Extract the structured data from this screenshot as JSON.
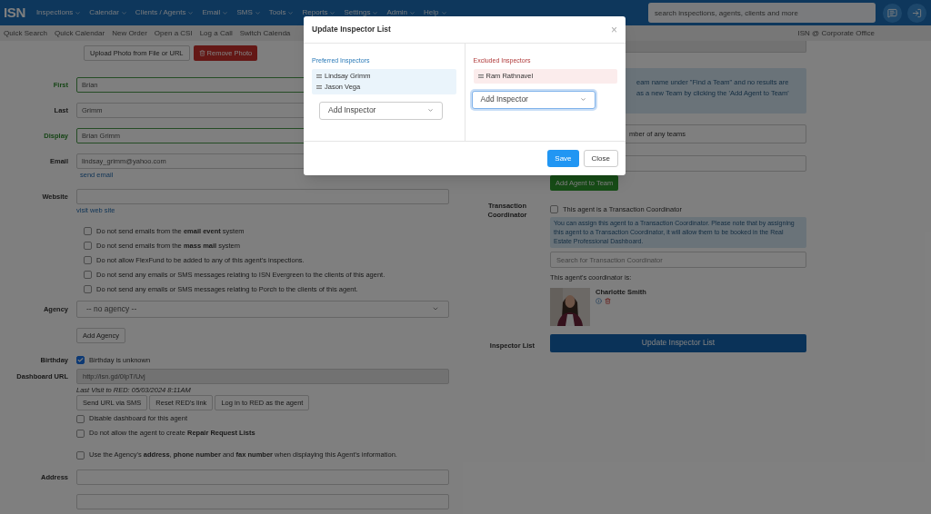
{
  "nav": {
    "logo": "ISN",
    "menus": [
      "Inspections",
      "Calendar",
      "Clients / Agents",
      "Email",
      "SMS",
      "Tools",
      "Reports",
      "Settings",
      "Admin",
      "Help"
    ],
    "search": {
      "placeholder": "search inspections, agents, clients and more"
    }
  },
  "quick_links": [
    "Quick Search",
    "Quick Calendar",
    "New Order",
    "Open a CSI",
    "Log a Call",
    "Switch Calenda"
  ],
  "office": "ISN @ Corporate Office",
  "photo_buttons": [
    {
      "label": "Upload Photo from File or URL",
      "kind": "default"
    },
    {
      "label": "Remove Photo",
      "kind": "danger"
    }
  ],
  "fields": [
    {
      "label": "First",
      "value": "Brian",
      "valid": true
    },
    {
      "label": "Last",
      "value": "Grimm",
      "valid": false
    },
    {
      "label": "Display",
      "value": "Brian Grimm",
      "valid": true
    },
    {
      "label": "Email",
      "value": "lindsay_grimm@yahoo.com",
      "valid": false,
      "link": "send email"
    },
    {
      "label": "Website",
      "valid": false,
      "link": "visit web site"
    }
  ],
  "email_options": [
    {
      "text": "Do not send emails from the **email event** system",
      "checked": false
    },
    {
      "text": "Do not send emails from the **mass mail** system",
      "checked": false
    },
    {
      "text": "Do not allow FlexFund to be added to any of this agent's inspections.",
      "checked": false
    },
    {
      "text": "Do not send any emails or SMS messages relating to ISN Evergreen to the clients of this agent.",
      "checked": false
    },
    {
      "text": "Do not send any emails or SMS messages relating to Porch to the clients of this agent.",
      "checked": false
    }
  ],
  "agency": {
    "label": "Agency",
    "value": "-- no agency --",
    "button": "Add Agency"
  },
  "birthday": {
    "label": "Birthday",
    "text": "Birthday is unknown",
    "checked": true
  },
  "dashboard": {
    "label": "Dashboard URL",
    "value": "http://isn.gd/0IpT/Uvj",
    "last_visit": "Last Visit to RED: 05/03/2024 8:11AM",
    "buttons": [
      "Send URL via SMS",
      "Reset RED's link",
      "Log in to RED as the agent"
    ],
    "options": [
      {
        "text": "Disable dashboard for this agent",
        "checked": false
      },
      {
        "text": "Do not allow the agent to create **Repair Request Lists**",
        "checked": false
      }
    ]
  },
  "agency_info_option": {
    "text": "Use the Agency's **address**, **phone number** and **fax number** when displaying this Agent's information.",
    "checked": false
  },
  "address": {
    "label": "Address"
  },
  "team": {
    "info_lines": [
      "eam name under \"Find a Team\" and no results are",
      "as a new Team by clicking the 'Add Agent to Team'"
    ],
    "membership": "mber of any teams",
    "button": "Add Agent to Team"
  },
  "transaction": {
    "label": "Transaction Coordinator",
    "option": {
      "text": "This agent is a Transaction Coordinator",
      "checked": false
    },
    "info": "You can assign this agent to a Transaction Coordinator. Please note that by assigning this agent to a Transaction Coordinator, it will allow them to be booked in the Real Estate Professional Dashboard.",
    "search_placeholder": "Search for Transaction Coordinator",
    "caption": "This agent's coordinator is:",
    "coordinator": {
      "name": "Charlotte Smith"
    }
  },
  "inspector_list": {
    "label": "Inspector List",
    "button": "Update Inspector List"
  },
  "modal": {
    "title": "Update Inspector List",
    "close": "×",
    "lists": [
      {
        "kind": "preferred",
        "title": "Preferred Inspectors",
        "items": [
          "Lindsay Grimm",
          "Jason Vega"
        ],
        "select": "Add Inspector",
        "focused": false
      },
      {
        "kind": "excluded",
        "title": "Excluded Inspectors",
        "items": [
          "Ram Rathnavel"
        ],
        "select": "Add Inspector",
        "focused": true
      }
    ],
    "buttons": [
      {
        "label": "Save",
        "kind": "primary"
      },
      {
        "label": "Close",
        "kind": "default"
      }
    ]
  }
}
